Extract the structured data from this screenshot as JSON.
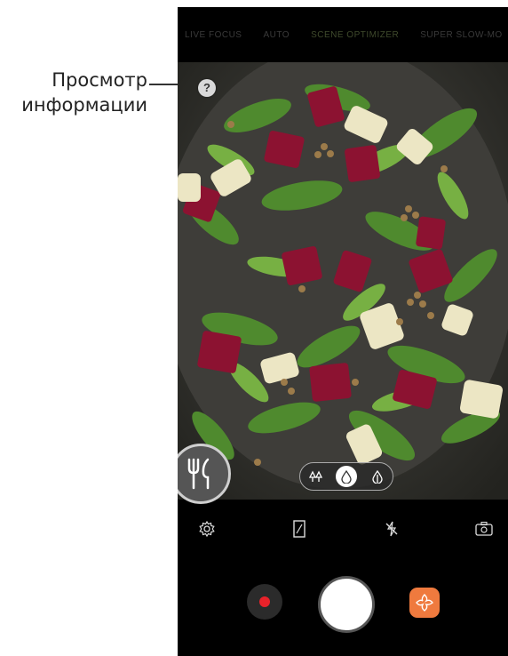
{
  "callout": {
    "line1": "Просмотр",
    "line2": "информации"
  },
  "modes": [
    "LIVE FOCUS",
    "AUTO",
    "SCENE OPTIMIZER",
    "SUPER SLOW-MO"
  ],
  "active_mode": "SCENE OPTIMIZER",
  "info_button": {
    "label": "?",
    "icon": "question-icon"
  },
  "scene": {
    "icon": "fork-knife-icon"
  },
  "effects": {
    "icons": [
      "blur-trees-icon",
      "drop-icon",
      "leaf-drop-icon"
    ],
    "selected": "drop-icon"
  },
  "toolbar": {
    "icons": [
      "settings-icon",
      "aspect-ratio-icon",
      "flash-off-icon",
      "switch-camera-icon"
    ]
  },
  "controls": {
    "record_color": "#e8222a",
    "gallery_color": "#ef7a3e",
    "icons": [
      "record-icon",
      "shutter-icon",
      "gallery-flower-icon"
    ]
  }
}
